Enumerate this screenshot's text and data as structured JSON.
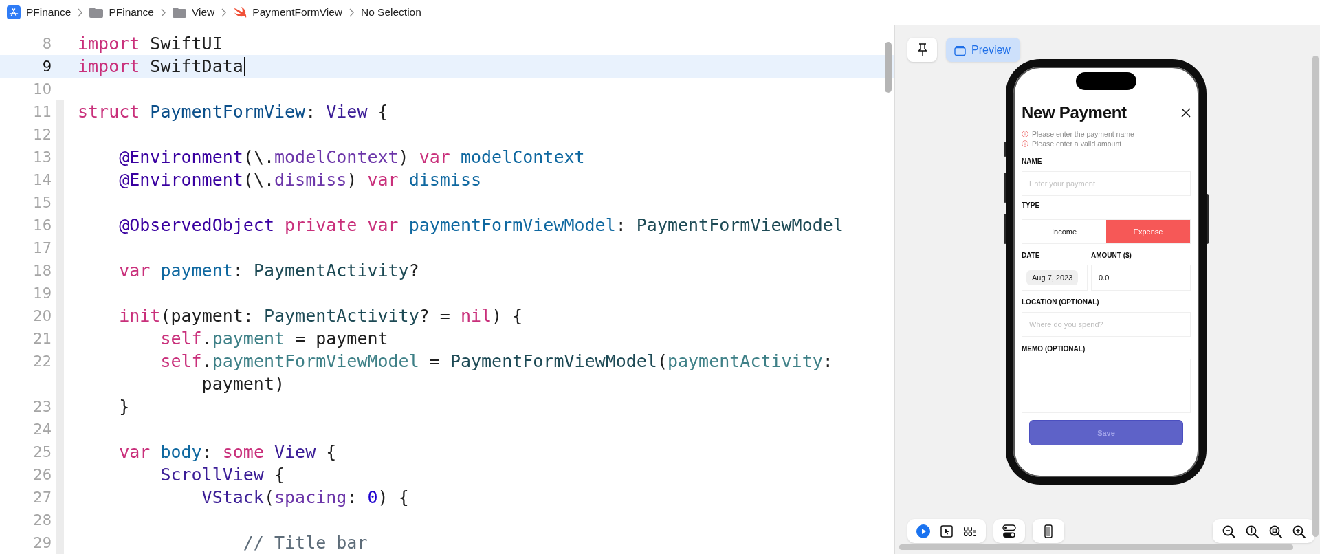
{
  "breadcrumb": [
    {
      "label": "PFinance",
      "kind": "app"
    },
    {
      "label": "PFinance",
      "kind": "folder"
    },
    {
      "label": "View",
      "kind": "folder"
    },
    {
      "label": "PaymentFormView",
      "kind": "swift"
    },
    {
      "label": "No Selection",
      "kind": "none"
    }
  ],
  "editor": {
    "lines": [
      {
        "number": "8",
        "current": false,
        "in_fold": false,
        "tokens": [
          {
            "kind": "kw",
            "text": "import"
          },
          {
            "kind": "plain",
            "text": " SwiftUI"
          }
        ]
      },
      {
        "number": "9",
        "current": true,
        "in_fold": false,
        "tokens": [
          {
            "kind": "kw",
            "text": "import"
          },
          {
            "kind": "plain",
            "text": " SwiftData"
          }
        ]
      },
      {
        "number": "10",
        "current": false,
        "in_fold": false
      },
      {
        "number": "11",
        "current": false,
        "in_fold": true,
        "tokens": [
          {
            "kind": "kw",
            "text": "struct"
          },
          {
            "kind": "typedecl",
            "text": " PaymentFormView"
          },
          {
            "kind": "plain",
            "text": ": "
          },
          {
            "kind": "typesys",
            "text": "View"
          },
          {
            "kind": "plain",
            "text": " {"
          }
        ]
      },
      {
        "number": "12",
        "current": false,
        "in_fold": true
      },
      {
        "number": "13",
        "current": false,
        "in_fold": true,
        "tokens": [
          {
            "kind": "attr",
            "text": "    @Environment"
          },
          {
            "kind": "plain",
            "text": "(\\."
          },
          {
            "kind": "member",
            "text": "modelContext"
          },
          {
            "kind": "plain",
            "text": ") "
          },
          {
            "kind": "kw",
            "text": "var"
          },
          {
            "kind": "decl",
            "text": " modelContext"
          }
        ]
      },
      {
        "number": "14",
        "current": false,
        "in_fold": true,
        "tokens": [
          {
            "kind": "attr",
            "text": "    @Environment"
          },
          {
            "kind": "plain",
            "text": "(\\."
          },
          {
            "kind": "member",
            "text": "dismiss"
          },
          {
            "kind": "plain",
            "text": ") "
          },
          {
            "kind": "kw",
            "text": "var"
          },
          {
            "kind": "decl",
            "text": " dismiss"
          }
        ]
      },
      {
        "number": "15",
        "current": false,
        "in_fold": true
      },
      {
        "number": "16",
        "current": false,
        "in_fold": true,
        "tokens": [
          {
            "kind": "attr",
            "text": "    @ObservedObject"
          },
          {
            "kind": "kw",
            "text": " private"
          },
          {
            "kind": "kw",
            "text": " var"
          },
          {
            "kind": "decl",
            "text": " paymentFormViewModel"
          },
          {
            "kind": "plain",
            "text": ": "
          },
          {
            "kind": "typeproj",
            "text": "PaymentFormViewModel"
          }
        ]
      },
      {
        "number": "17",
        "current": false,
        "in_fold": true
      },
      {
        "number": "18",
        "current": false,
        "in_fold": true,
        "tokens": [
          {
            "kind": "kw",
            "text": "    var"
          },
          {
            "kind": "decl",
            "text": " payment"
          },
          {
            "kind": "plain",
            "text": ": "
          },
          {
            "kind": "typeproj",
            "text": "PaymentActivity"
          },
          {
            "kind": "plain",
            "text": "?"
          }
        ]
      },
      {
        "number": "19",
        "current": false,
        "in_fold": true
      },
      {
        "number": "20",
        "current": false,
        "in_fold": true,
        "tokens": [
          {
            "kind": "kw",
            "text": "    init"
          },
          {
            "kind": "plain",
            "text": "(payment: "
          },
          {
            "kind": "typeproj",
            "text": "PaymentActivity"
          },
          {
            "kind": "plain",
            "text": "? = "
          },
          {
            "kind": "kw",
            "text": "nil"
          },
          {
            "kind": "plain",
            "text": ") {"
          }
        ]
      },
      {
        "number": "21",
        "current": false,
        "in_fold": true,
        "tokens": [
          {
            "kind": "kw",
            "text": "        self"
          },
          {
            "kind": "plain",
            "text": "."
          },
          {
            "kind": "prop",
            "text": "payment"
          },
          {
            "kind": "plain",
            "text": " = payment"
          }
        ]
      },
      {
        "number": "22",
        "current": false,
        "in_fold": true,
        "tokens": [
          {
            "kind": "kw",
            "text": "        self"
          },
          {
            "kind": "plain",
            "text": "."
          },
          {
            "kind": "prop",
            "text": "paymentFormViewModel"
          },
          {
            "kind": "plain",
            "text": " = "
          },
          {
            "kind": "typeproj",
            "text": "PaymentFormViewModel"
          },
          {
            "kind": "plain",
            "text": "("
          },
          {
            "kind": "prop",
            "text": "paymentActivity"
          },
          {
            "kind": "plain",
            "text": ":"
          }
        ]
      },
      {
        "current": false,
        "in_fold": true,
        "tokens": [
          {
            "kind": "plain",
            "text": "            payment)"
          }
        ]
      },
      {
        "number": "23",
        "current": false,
        "in_fold": true,
        "tokens": [
          {
            "kind": "plain",
            "text": "    }"
          }
        ]
      },
      {
        "number": "24",
        "current": false,
        "in_fold": true
      },
      {
        "number": "25",
        "current": false,
        "in_fold": true,
        "tokens": [
          {
            "kind": "kw",
            "text": "    var"
          },
          {
            "kind": "decl",
            "text": " body"
          },
          {
            "kind": "plain",
            "text": ": "
          },
          {
            "kind": "kw",
            "text": "some"
          },
          {
            "kind": "typesys",
            "text": " View"
          },
          {
            "kind": "plain",
            "text": " {"
          }
        ]
      },
      {
        "number": "26",
        "current": false,
        "in_fold": true,
        "tokens": [
          {
            "kind": "typesys",
            "text": "        ScrollView"
          },
          {
            "kind": "plain",
            "text": " {"
          }
        ]
      },
      {
        "number": "27",
        "current": false,
        "in_fold": true,
        "tokens": [
          {
            "kind": "typesys",
            "text": "            VStack"
          },
          {
            "kind": "plain",
            "text": "("
          },
          {
            "kind": "member",
            "text": "spacing"
          },
          {
            "kind": "plain",
            "text": ": "
          },
          {
            "kind": "num",
            "text": "0"
          },
          {
            "kind": "plain",
            "text": ") {"
          }
        ]
      },
      {
        "number": "28",
        "current": false,
        "in_fold": true
      },
      {
        "number": "29",
        "current": false,
        "in_fold": true,
        "tokens": [
          {
            "kind": "comment",
            "text": "                // Title bar"
          }
        ]
      }
    ]
  },
  "preview": {
    "preview_button": {
      "label": "Preview",
      "selected": true
    },
    "form": {
      "title": "New Payment",
      "errors": [
        "Please enter the payment name",
        "Please enter a valid amount"
      ],
      "name": {
        "label": "NAME",
        "placeholder": "Enter your payment"
      },
      "type": {
        "label": "TYPE",
        "options": [
          {
            "label": "Income",
            "selected": false
          },
          {
            "label": "Expense",
            "selected": true
          }
        ]
      },
      "date": {
        "label": "DATE",
        "value": "Aug 7, 2023"
      },
      "amount": {
        "label": "AMOUNT ($)",
        "value": "0.0"
      },
      "location": {
        "label": "LOCATION (OPTIONAL)",
        "placeholder": "Where do you spend?"
      },
      "memo": {
        "label": "MEMO (OPTIONAL)"
      },
      "save": {
        "label": "Save",
        "disabled": true
      }
    },
    "bottom_toolbar": {
      "groups": [
        {
          "items": [
            {
              "kind": "live",
              "selected": true
            },
            {
              "kind": "select",
              "selected": false
            },
            {
              "kind": "variants",
              "selected": false
            }
          ]
        },
        {
          "items": [
            {
              "kind": "settings",
              "selected": false
            }
          ]
        },
        {
          "items": [
            {
              "kind": "device",
              "selected": false
            }
          ]
        },
        {
          "items": [
            {
              "kind": "zoom_out",
              "selected": false
            },
            {
              "kind": "zoom_actual",
              "selected": false
            },
            {
              "kind": "zoom_fit",
              "selected": false
            },
            {
              "kind": "zoom_in",
              "selected": false
            }
          ]
        }
      ]
    }
  }
}
